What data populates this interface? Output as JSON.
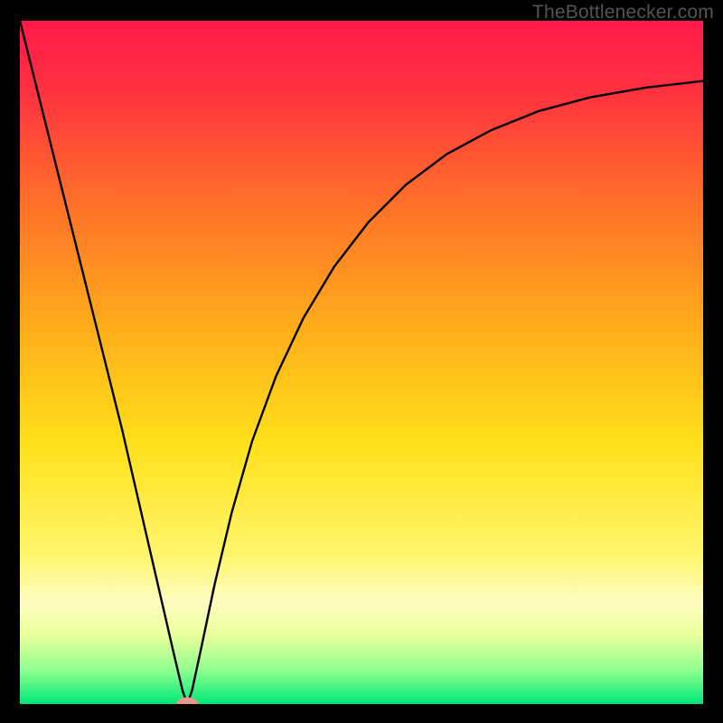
{
  "watermark": "TheBottleneсker.com",
  "chart_data": {
    "type": "line",
    "title": "",
    "xlabel": "",
    "ylabel": "",
    "xlim": [
      0,
      1
    ],
    "ylim": [
      0,
      1
    ],
    "background_gradient_stops": [
      {
        "offset": 0.0,
        "color": "#ff1a4a"
      },
      {
        "offset": 0.1,
        "color": "#ff3040"
      },
      {
        "offset": 0.25,
        "color": "#ff6a2a"
      },
      {
        "offset": 0.45,
        "color": "#ffad1a"
      },
      {
        "offset": 0.62,
        "color": "#ffe01a"
      },
      {
        "offset": 0.78,
        "color": "#fff56a"
      },
      {
        "offset": 0.85,
        "color": "#fffcc0"
      },
      {
        "offset": 0.9,
        "color": "#e8ff9a"
      },
      {
        "offset": 0.95,
        "color": "#90ff90"
      },
      {
        "offset": 1.0,
        "color": "#00e878"
      }
    ],
    "curve_min_x": 0.245,
    "curve": [
      {
        "x": 0.0,
        "y": 1.0
      },
      {
        "x": 0.03,
        "y": 0.88
      },
      {
        "x": 0.06,
        "y": 0.76
      },
      {
        "x": 0.09,
        "y": 0.64
      },
      {
        "x": 0.12,
        "y": 0.52
      },
      {
        "x": 0.15,
        "y": 0.4
      },
      {
        "x": 0.18,
        "y": 0.27
      },
      {
        "x": 0.21,
        "y": 0.14
      },
      {
        "x": 0.225,
        "y": 0.075
      },
      {
        "x": 0.238,
        "y": 0.02
      },
      {
        "x": 0.245,
        "y": 0.0
      },
      {
        "x": 0.252,
        "y": 0.02
      },
      {
        "x": 0.265,
        "y": 0.08
      },
      {
        "x": 0.285,
        "y": 0.175
      },
      {
        "x": 0.31,
        "y": 0.28
      },
      {
        "x": 0.34,
        "y": 0.385
      },
      {
        "x": 0.375,
        "y": 0.48
      },
      {
        "x": 0.415,
        "y": 0.565
      },
      {
        "x": 0.46,
        "y": 0.64
      },
      {
        "x": 0.51,
        "y": 0.705
      },
      {
        "x": 0.565,
        "y": 0.76
      },
      {
        "x": 0.625,
        "y": 0.805
      },
      {
        "x": 0.69,
        "y": 0.84
      },
      {
        "x": 0.76,
        "y": 0.868
      },
      {
        "x": 0.835,
        "y": 0.888
      },
      {
        "x": 0.915,
        "y": 0.902
      },
      {
        "x": 1.0,
        "y": 0.912
      }
    ],
    "marker": {
      "x": 0.245,
      "y": 0.0,
      "rx": 0.016,
      "ry": 0.01,
      "color": "#e59a8a"
    }
  }
}
